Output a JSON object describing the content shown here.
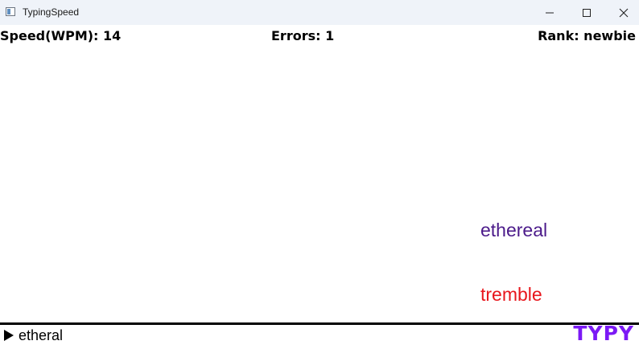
{
  "window": {
    "title": "TypingSpeed",
    "icon": "app-window-icon",
    "controls": [
      "minimize-icon",
      "maximize-icon",
      "close-icon"
    ]
  },
  "stats": {
    "speed": "Speed(WPM): 14",
    "errors": "Errors: 1",
    "rank": "Rank: newbie"
  },
  "words": [
    {
      "text": "ethereal",
      "color": "#4b1a8a"
    },
    {
      "text": "tremble",
      "color": "#e8161c"
    }
  ],
  "input": {
    "prompt_icon": "play-triangle-icon",
    "typed_text": "etheral"
  },
  "logo": {
    "text": "TYPY",
    "color": "#7b19f5"
  }
}
